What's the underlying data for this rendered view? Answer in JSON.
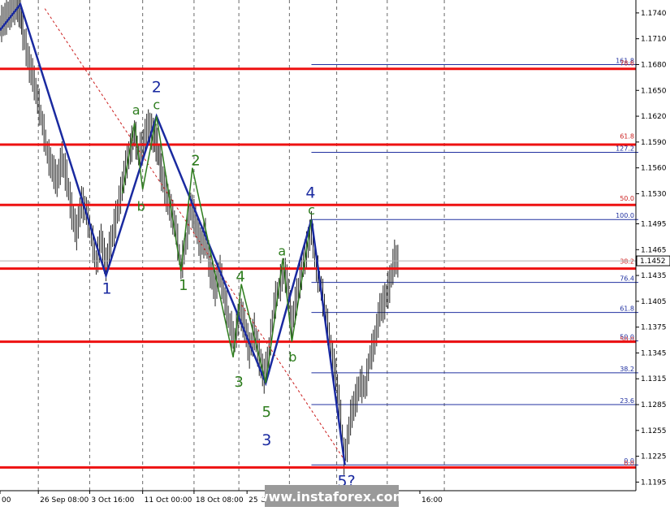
{
  "chart_data": {
    "type": "line",
    "title": "",
    "ylim": [
      1.1185,
      1.1755
    ],
    "y_ticks": [
      1.1195,
      1.1225,
      1.1255,
      1.1285,
      1.1315,
      1.1345,
      1.1375,
      1.1405,
      1.1435,
      1.1465,
      1.1495,
      1.153,
      1.156,
      1.159,
      1.162,
      1.165,
      1.168,
      1.171,
      1.174
    ],
    "y_tick_labels": [
      "1.1195",
      "1.1225",
      "1.1255",
      "1.1285",
      "1.1315",
      "1.1345",
      "1.1375",
      "1.1405",
      "1.1435",
      "1.1465",
      "1.1495",
      "1.1530",
      "1.1560",
      "1.1590",
      "1.1620",
      "1.1650",
      "1.1680",
      "1.1710",
      "1.1740"
    ],
    "current_price": 1.1452,
    "current_price_label": "1.1452",
    "x_index_range": [
      0,
      780
    ],
    "x_ticks": [
      {
        "x": 0,
        "label": "00"
      },
      {
        "x": 47,
        "label": "26 Sep 08:00"
      },
      {
        "x": 110,
        "label": "3 Oct 16:00"
      },
      {
        "x": 175,
        "label": "11 Oct 00:00"
      },
      {
        "x": 238,
        "label": "18 Oct 08:00"
      },
      {
        "x": 303,
        "label": "25 Oct 16:00"
      },
      {
        "x": 515,
        "label": "16:00"
      }
    ],
    "vertical_grid_x": [
      47,
      110,
      175,
      238,
      293,
      355,
      413,
      475,
      545
    ],
    "horizontal_levels": [
      1.1675,
      1.1587,
      1.1517,
      1.1443,
      1.1358,
      1.1212
    ],
    "fib_upper": {
      "x_range": [
        382,
        783
      ],
      "levels": [
        {
          "price": 1.168,
          "label": "161.8",
          "label2": "78.6"
        },
        {
          "price": 1.1578,
          "label": "127.2"
        },
        {
          "price": 1.15,
          "label": "100.0"
        },
        {
          "price": 1.1427,
          "label": "76.4"
        },
        {
          "price": 1.1392,
          "label": "61.8"
        },
        {
          "price": 1.1359,
          "label": "50.0",
          "label2": "50.0"
        },
        {
          "price": 1.1322,
          "label": "38.2"
        },
        {
          "price": 1.1285,
          "label": "23.6"
        },
        {
          "price": 1.1215,
          "label": "0.0",
          "label2": "0.0"
        }
      ]
    },
    "fib_red_labels": [
      {
        "price": 1.1592,
        "label": "61.8"
      },
      {
        "price": 1.152,
        "label": "50.0"
      },
      {
        "price": 1.1447,
        "label": "38.2"
      }
    ],
    "price_series": {
      "name": "",
      "x": [
        0,
        10,
        20,
        25,
        28,
        32,
        36,
        40,
        46,
        52,
        58,
        64,
        70,
        76,
        82,
        88,
        94,
        100,
        106,
        112,
        118,
        124,
        130,
        136,
        142,
        148,
        154,
        160,
        165,
        170,
        176,
        182,
        188,
        193,
        198,
        204,
        210,
        216,
        222,
        228,
        234,
        240,
        246,
        252,
        258,
        264,
        270,
        276,
        282,
        288,
        294,
        300,
        306,
        312,
        318,
        324,
        330,
        336,
        342,
        348,
        352,
        358,
        364,
        370,
        376,
        382,
        388,
        394,
        400,
        406,
        412,
        418,
        422,
        426,
        430,
        436,
        442,
        448,
        454,
        460,
        466,
        472,
        478,
        484,
        490
      ],
      "y": [
        1.1725,
        1.1738,
        1.175,
        1.1742,
        1.1718,
        1.17,
        1.168,
        1.1668,
        1.164,
        1.1612,
        1.1578,
        1.156,
        1.1545,
        1.157,
        1.1548,
        1.151,
        1.1485,
        1.152,
        1.151,
        1.1482,
        1.145,
        1.1478,
        1.1448,
        1.1472,
        1.15,
        1.1528,
        1.156,
        1.1582,
        1.16,
        1.1575,
        1.159,
        1.161,
        1.1598,
        1.1585,
        1.1555,
        1.153,
        1.151,
        1.1488,
        1.1445,
        1.1472,
        1.1515,
        1.1498,
        1.147,
        1.148,
        1.1442,
        1.142,
        1.144,
        1.1405,
        1.1378,
        1.136,
        1.1395,
        1.1378,
        1.1348,
        1.137,
        1.134,
        1.1318,
        1.1345,
        1.14,
        1.142,
        1.144,
        1.143,
        1.138,
        1.141,
        1.144,
        1.1465,
        1.149,
        1.1445,
        1.142,
        1.1388,
        1.135,
        1.132,
        1.127,
        1.1225,
        1.124,
        1.127,
        1.129,
        1.131,
        1.1305,
        1.134,
        1.136,
        1.1395,
        1.1405,
        1.1425,
        1.1455,
        1.145
      ]
    },
    "wave_lines": [
      {
        "name": "blue-wave",
        "color": "#1a2aa0",
        "points": [
          [
            0,
            1.172
          ],
          [
            25,
            1.175
          ],
          [
            130,
            1.1435
          ],
          [
            192,
            1.162
          ],
          [
            326,
            1.131
          ],
          [
            382,
            1.15
          ],
          [
            423,
            1.1215
          ]
        ]
      },
      {
        "name": "green-wave-1",
        "color": "#2e7d1e",
        "points": [
          [
            150,
            1.153
          ],
          [
            165,
            1.1612
          ],
          [
            175,
            1.1535
          ],
          [
            192,
            1.162
          ],
          [
            222,
            1.144
          ],
          [
            236,
            1.156
          ],
          [
            286,
            1.134
          ],
          [
            296,
            1.1425
          ],
          [
            326,
            1.131
          ]
        ]
      },
      {
        "name": "green-wave-2",
        "color": "#2e7d1e",
        "points": [
          [
            326,
            1.131
          ],
          [
            347,
            1.1455
          ],
          [
            358,
            1.1358
          ],
          [
            382,
            1.15
          ]
        ]
      }
    ],
    "trend_line": {
      "color": "#cc2222",
      "points": [
        [
          55,
          1.1745
        ],
        [
          423,
          1.122
        ]
      ]
    },
    "wave_labels": [
      {
        "text": "a",
        "x": 167,
        "price": 1.1622,
        "color": "#2e7d1e",
        "size": 16
      },
      {
        "text": "2",
        "x": 192,
        "price": 1.1648,
        "color": "#1a2aa0",
        "size": 19
      },
      {
        "text": "c",
        "x": 192,
        "price": 1.1628,
        "color": "#2e7d1e",
        "size": 16
      },
      {
        "text": "2",
        "x": 240,
        "price": 1.1563,
        "color": "#2e7d1e",
        "size": 18
      },
      {
        "text": "b",
        "x": 173,
        "price": 1.151,
        "color": "#2e7d1e",
        "size": 16
      },
      {
        "text": "1",
        "x": 131,
        "price": 1.1414,
        "color": "#1a2aa0",
        "size": 19
      },
      {
        "text": "1",
        "x": 225,
        "price": 1.1418,
        "color": "#2e7d1e",
        "size": 18
      },
      {
        "text": "4",
        "x": 295,
        "price": 1.1428,
        "color": "#2e7d1e",
        "size": 18
      },
      {
        "text": "3",
        "x": 293,
        "price": 1.1306,
        "color": "#2e7d1e",
        "size": 18
      },
      {
        "text": "a",
        "x": 346,
        "price": 1.1458,
        "color": "#2e7d1e",
        "size": 16
      },
      {
        "text": "b",
        "x": 359,
        "price": 1.1335,
        "color": "#2e7d1e",
        "size": 16
      },
      {
        "text": "4",
        "x": 381,
        "price": 1.1525,
        "color": "#1a2aa0",
        "size": 19
      },
      {
        "text": "c",
        "x": 382,
        "price": 1.1506,
        "color": "#2e7d1e",
        "size": 16
      },
      {
        "text": "5",
        "x": 327,
        "price": 1.1271,
        "color": "#2e7d1e",
        "size": 18
      },
      {
        "text": "3",
        "x": 327,
        "price": 1.1238,
        "color": "#1a2aa0",
        "size": 19
      },
      {
        "text": "5?",
        "x": 425,
        "price": 1.119,
        "color": "#1a2aa0",
        "size": 19
      }
    ],
    "watermark": "www.instaforex.com"
  }
}
